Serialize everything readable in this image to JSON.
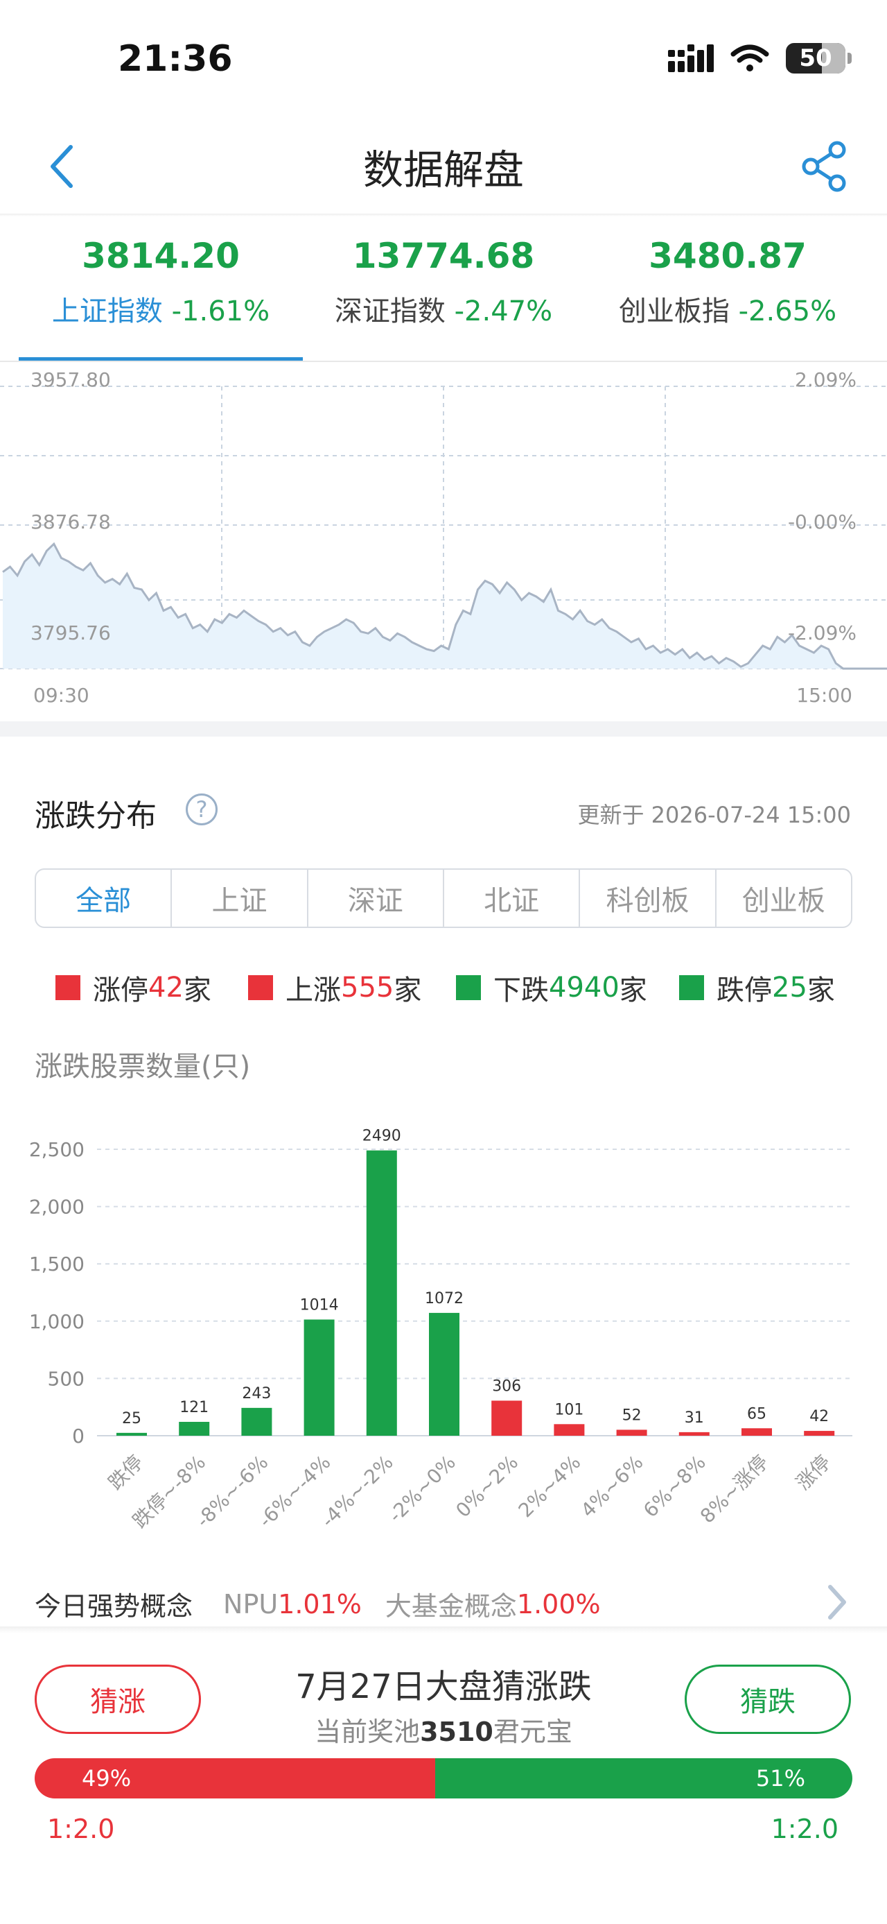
{
  "status_bar": {
    "time": "21:36",
    "battery": "50"
  },
  "nav": {
    "title": "数据解盘"
  },
  "indices": [
    {
      "value": "3814.20",
      "name": "上证指数",
      "change": "-1.61%",
      "active": true
    },
    {
      "value": "13774.68",
      "name": "深证指数",
      "change": "-2.47%",
      "active": false
    },
    {
      "value": "3480.87",
      "name": "创业板指",
      "change": "-2.65%",
      "active": false
    }
  ],
  "intraday": {
    "y_left_labels": [
      "3957.80",
      "3876.78",
      "3795.76"
    ],
    "y_right_labels": [
      "2.09%",
      "-0.00%",
      "-2.09%"
    ],
    "x_start": "09:30",
    "x_end": "15:00",
    "ylim": [
      3795.76,
      3957.8
    ],
    "values": [
      3852,
      3855,
      3850,
      3858,
      3862,
      3856,
      3864,
      3868,
      3860,
      3858,
      3855,
      3853,
      3857,
      3850,
      3846,
      3848,
      3845,
      3851,
      3843,
      3842,
      3836,
      3840,
      3830,
      3832,
      3826,
      3828,
      3820,
      3822,
      3818,
      3825,
      3823,
      3828,
      3826,
      3830,
      3827,
      3824,
      3822,
      3818,
      3820,
      3816,
      3818,
      3812,
      3810,
      3815,
      3818,
      3820,
      3822,
      3825,
      3823,
      3818,
      3817,
      3820,
      3815,
      3813,
      3817,
      3815,
      3812,
      3810,
      3808,
      3807,
      3810,
      3808,
      3822,
      3830,
      3828,
      3842,
      3847,
      3845,
      3840,
      3846,
      3842,
      3836,
      3840,
      3838,
      3835,
      3842,
      3830,
      3828,
      3825,
      3830,
      3824,
      3822,
      3825,
      3820,
      3818,
      3815,
      3812,
      3814,
      3808,
      3810,
      3806,
      3808,
      3805,
      3808,
      3803,
      3806,
      3802,
      3804,
      3800,
      3803,
      3801,
      3798,
      3800,
      3805,
      3810,
      3808,
      3815,
      3812,
      3816,
      3810,
      3808,
      3806,
      3810,
      3808,
      3800,
      3796,
      3795,
      3790,
      3792,
      3788,
      3789,
      3788
    ],
    "colors": {
      "line": "#a8b4c4",
      "fill": "#e8f3fc"
    }
  },
  "distribution": {
    "title": "涨跌分布",
    "help": "?",
    "updated": "更新于 2026-07-24 15:00",
    "tabs": [
      "全部",
      "上证",
      "深证",
      "北证",
      "科创板",
      "创业板"
    ],
    "legend": [
      {
        "label": "涨停",
        "count": "42",
        "unit": "家",
        "color": "#e8333a"
      },
      {
        "label": "上涨",
        "count": "555",
        "unit": "家",
        "color": "#e8333a"
      },
      {
        "label": "下跌",
        "count": "4940",
        "unit": "家",
        "color": "#1aa14a"
      },
      {
        "label": "跌停",
        "count": "25",
        "unit": "家",
        "color": "#1aa14a"
      }
    ],
    "ylabel": "涨跌股票数量(只)"
  },
  "chart_data": {
    "type": "bar",
    "ylabel": "涨跌股票数量(只)",
    "ylim": [
      0,
      2500
    ],
    "yticks": [
      "0",
      "500",
      "1,000",
      "1,500",
      "2,000",
      "2,500"
    ],
    "categories": [
      "跌停",
      "跌停~-8%",
      "-8%~-6%",
      "-6%~-4%",
      "-4%~-2%",
      "-2%~0%",
      "0%~2%",
      "2%~4%",
      "4%~6%",
      "6%~8%",
      "8%~涨停",
      "涨停"
    ],
    "values": [
      25,
      121,
      243,
      1014,
      2490,
      1072,
      306,
      101,
      52,
      31,
      65,
      42
    ],
    "colors": [
      "#1aa14a",
      "#1aa14a",
      "#1aa14a",
      "#1aa14a",
      "#1aa14a",
      "#1aa14a",
      "#e8333a",
      "#e8333a",
      "#e8333a",
      "#e8333a",
      "#e8333a",
      "#e8333a"
    ],
    "grid": true
  },
  "concepts": {
    "label": "今日强势概念",
    "items": [
      {
        "name": "NPU",
        "change": "1.01%"
      },
      {
        "name": "大基金概念",
        "change": "1.00%"
      }
    ]
  },
  "guess": {
    "title": "7月27日大盘猜涨跌",
    "pool_prefix": "当前奖池",
    "pool_amount": "3510",
    "pool_suffix": "君元宝",
    "up_label": "猜涨",
    "down_label": "猜跌",
    "up_percent": "49%",
    "down_percent": "51%",
    "up_share": 0.49,
    "up_odds": "1:2.0",
    "down_odds": "1:2.0"
  }
}
